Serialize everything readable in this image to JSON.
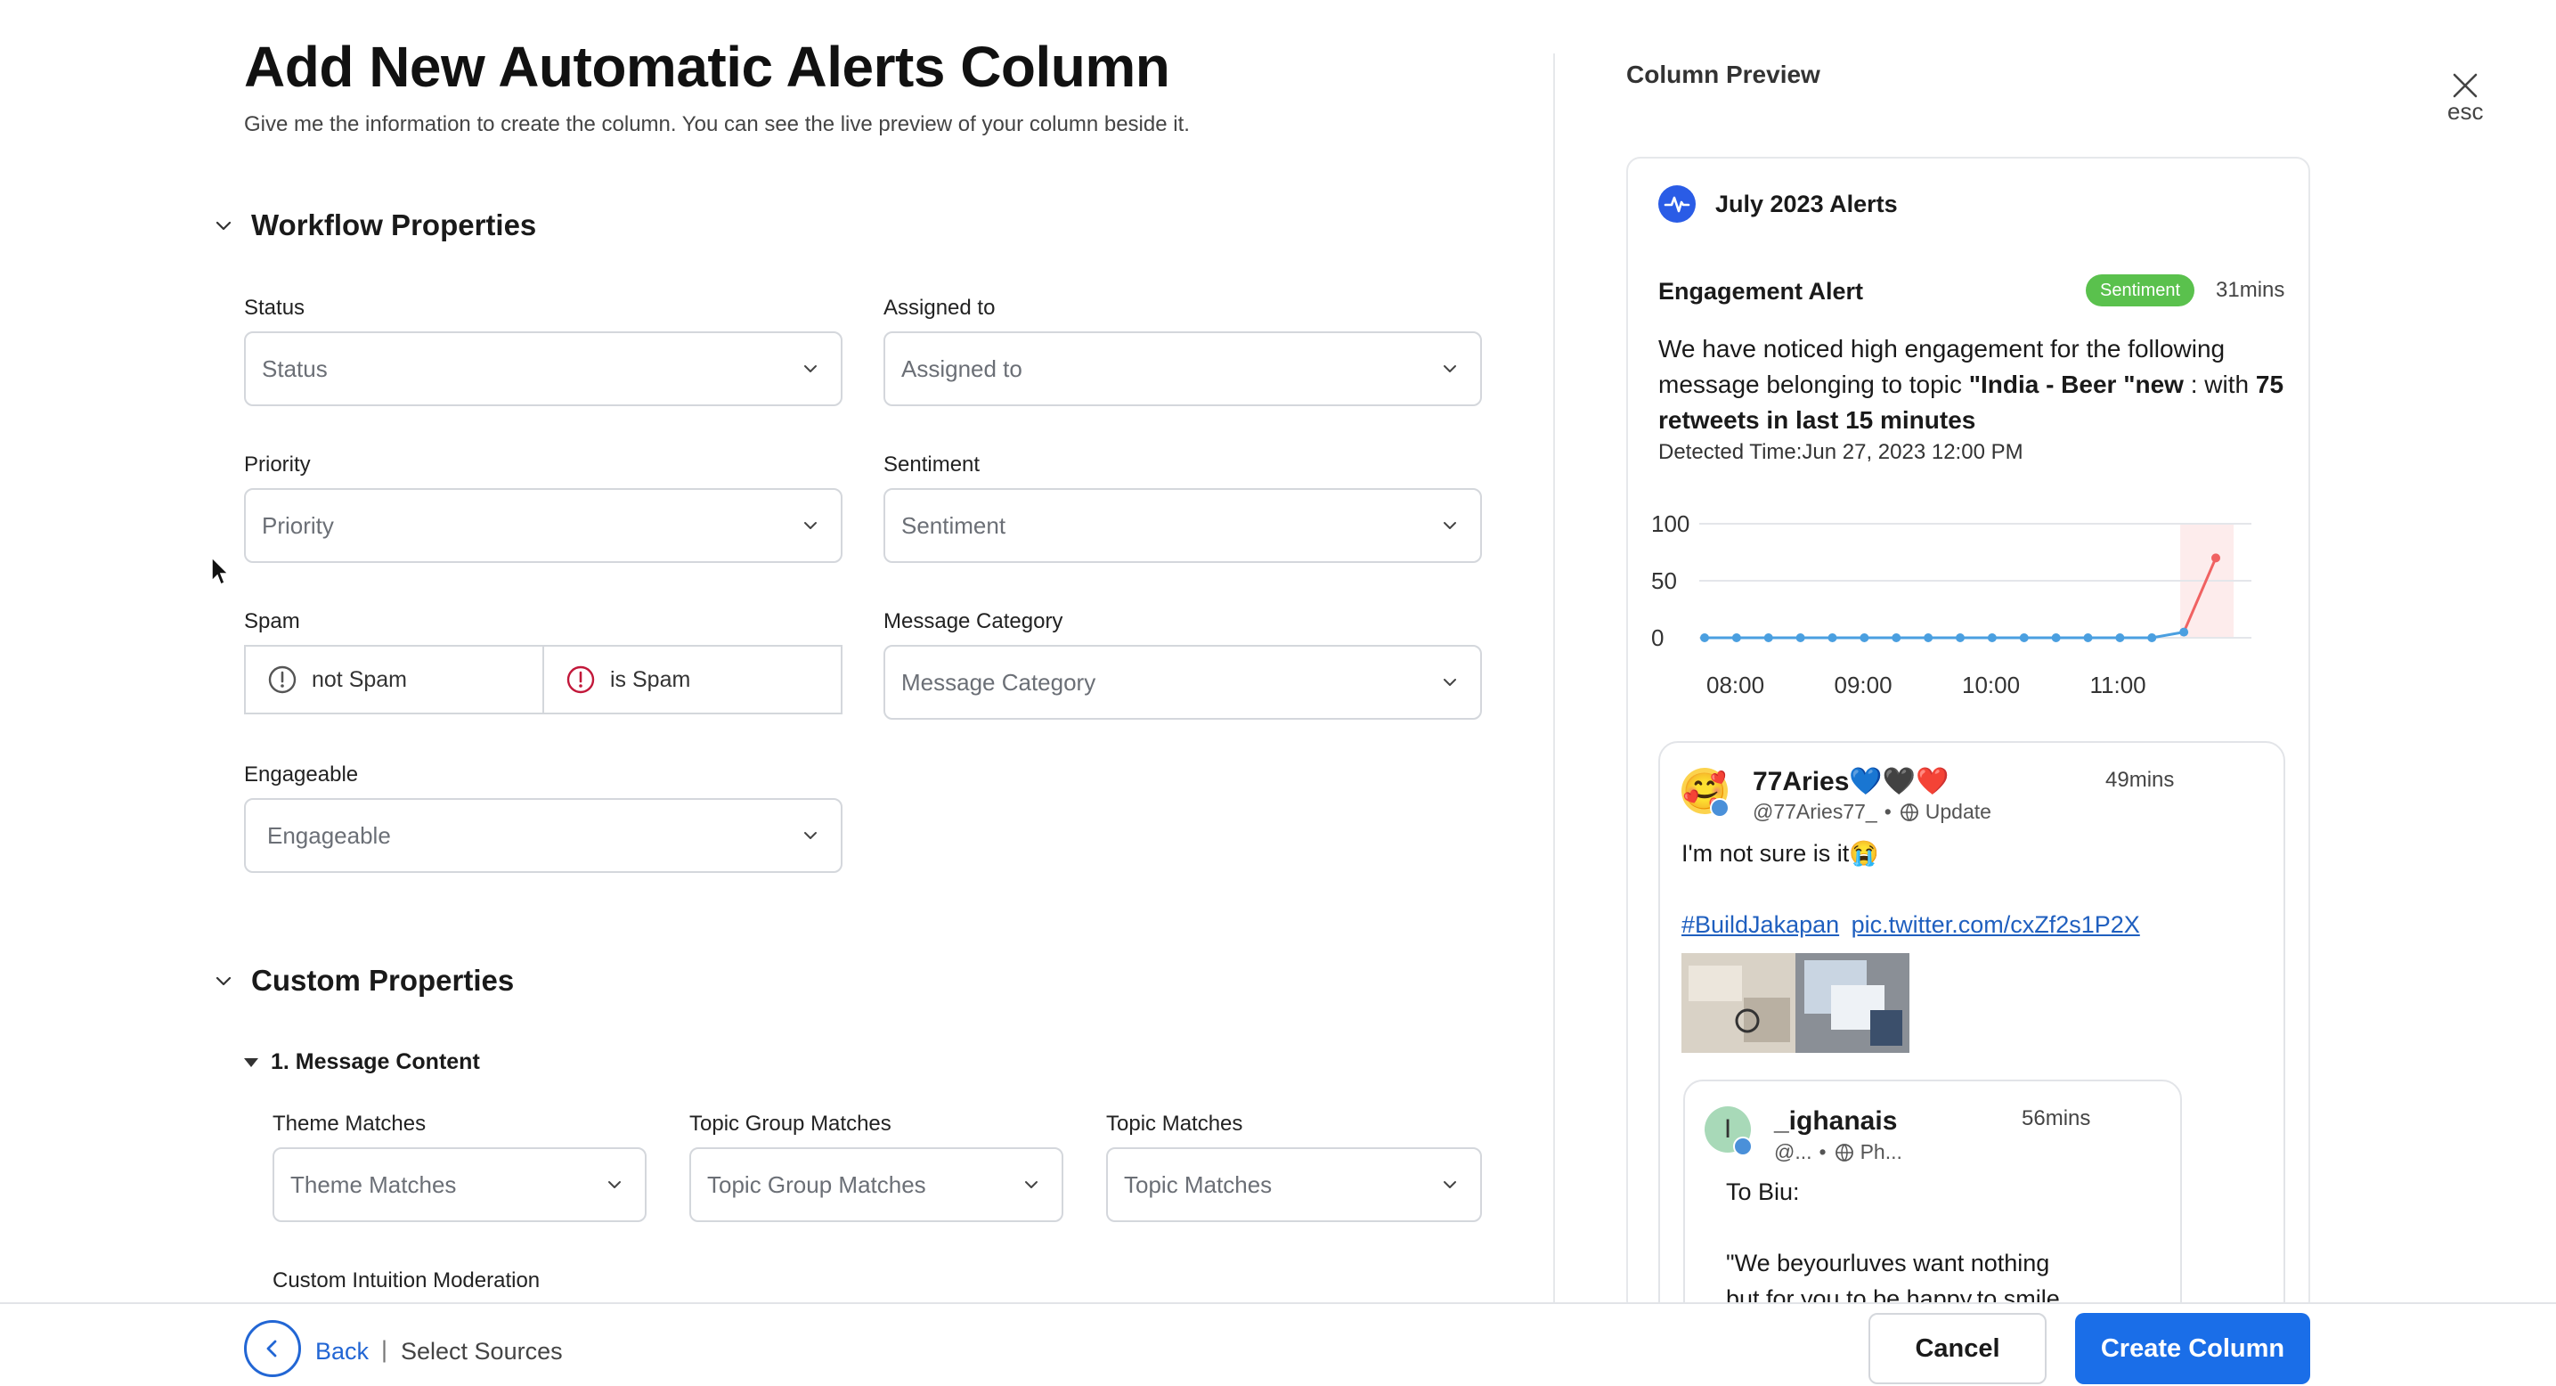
{
  "header": {
    "title": "Add New Automatic Alerts Column",
    "subtitle": "Give me the information to create the column. You can see the live preview of your column beside it."
  },
  "workflow": {
    "title": "Workflow Properties",
    "status": {
      "label": "Status",
      "placeholder": "Status"
    },
    "assigned": {
      "label": "Assigned to",
      "placeholder": "Assigned to"
    },
    "priority": {
      "label": "Priority",
      "placeholder": "Priority"
    },
    "sentiment": {
      "label": "Sentiment",
      "placeholder": "Sentiment"
    },
    "spam": {
      "label": "Spam",
      "not_spam": "not Spam",
      "is_spam": "is Spam"
    },
    "message_category": {
      "label": "Message Category",
      "placeholder": "Message Category"
    },
    "engageable": {
      "label": "Engageable",
      "placeholder": "Engageable"
    }
  },
  "custom": {
    "title": "Custom Properties",
    "message_content": {
      "title": "1. Message Content",
      "theme": {
        "label": "Theme Matches",
        "placeholder": "Theme Matches"
      },
      "topic_group": {
        "label": "Topic Group Matches",
        "placeholder": "Topic Group Matches"
      },
      "topic": {
        "label": "Topic Matches",
        "placeholder": "Topic Matches"
      },
      "intuition_label": "Custom Intuition Moderation"
    }
  },
  "preview": {
    "title": "Column Preview",
    "esc": "esc",
    "column_name": "July 2023 Alerts",
    "alert": {
      "title": "Engagement Alert",
      "badge": "Sentiment",
      "time": "31mins",
      "text_1": "We have noticed high engagement for the following message belonging to topic ",
      "topic": "\"India - Beer \"new",
      "text_2": " : with ",
      "stat": "75 retweets in last 15 minutes",
      "detected": "Detected Time:Jun 27, 2023 12:00 PM"
    },
    "tweet": {
      "name": "77Aries💙🖤❤️",
      "handle": "@77Aries77_",
      "dot": "•",
      "tag": "Update",
      "time": "49mins",
      "text": "I'm not sure is it😭",
      "hashtag": "#BuildJakapan",
      "link": "pic.twitter.com/cxZf2s1P2X",
      "reply": {
        "initial": "I",
        "name": "_ighanais",
        "handle": "@...",
        "dot": "•",
        "tag": "Ph...",
        "time": "56mins",
        "line1": "To Biu:",
        "line2": "\"We beyourluves want nothing",
        "line3": "but for you to be happy,to smile"
      }
    }
  },
  "chart_data": {
    "type": "line",
    "x_ticks": [
      "08:00",
      "09:00",
      "10:00",
      "11:00"
    ],
    "y_ticks": [
      "100",
      "50",
      "0"
    ],
    "ylim": [
      0,
      100
    ],
    "values": [
      0,
      0,
      0,
      0,
      0,
      0,
      0,
      0,
      0,
      0,
      0,
      0,
      0,
      0,
      0,
      5,
      70
    ],
    "colors": {
      "normal": "#4a9fe0",
      "spike": "#f06262"
    }
  },
  "footer": {
    "back": "Back",
    "separator": "|",
    "crumb": "Select Sources",
    "cancel": "Cancel",
    "create": "Create Column"
  }
}
